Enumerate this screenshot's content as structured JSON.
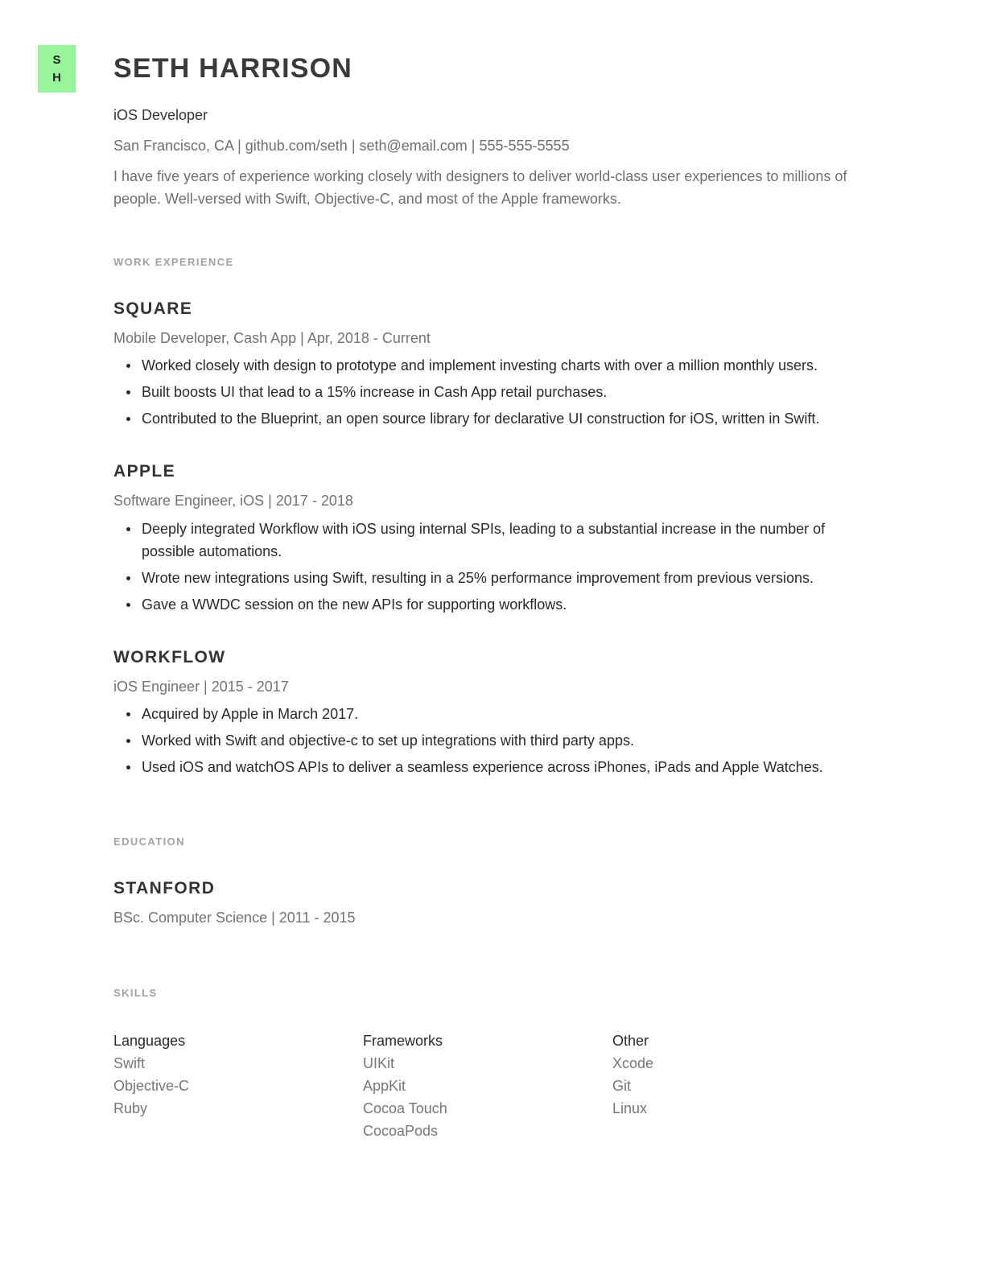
{
  "badge": {
    "line1": "S",
    "line2": "H",
    "color": "#98f59a"
  },
  "header": {
    "name": "SETH HARRISON",
    "title": "iOS Developer",
    "contact": "San Francisco, CA | github.com/seth | seth@email.com | 555-555-5555",
    "summary": "I have five years of experience working closely with designers to deliver world-class user experiences to millions of people. Well-versed with Swift, Objective-C, and most of the Apple frameworks."
  },
  "work": {
    "label": "WORK EXPERIENCE",
    "jobs": [
      {
        "company": "SQUARE",
        "role": "Mobile Developer, Cash App | Apr, 2018 - Current",
        "bullets": [
          "Worked closely with design to prototype and implement investing charts with over a million monthly users.",
          "Built boosts UI that lead to a 15% increase in Cash App retail purchases.",
          "Contributed to the Blueprint, an open source library for declarative UI construction for iOS, written in Swift."
        ]
      },
      {
        "company": "APPLE",
        "role": "Software Engineer, iOS | 2017 - 2018",
        "bullets": [
          "Deeply integrated Workflow with iOS using internal SPIs, leading to a substantial increase in the number of possible automations.",
          "Wrote new integrations using Swift, resulting in a 25% performance improvement from previous versions.",
          "Gave a WWDC session on the new APIs for supporting workflows."
        ]
      },
      {
        "company": "WORKFLOW",
        "role": "iOS Engineer | 2015 - 2017",
        "bullets": [
          "Acquired by Apple in March 2017.",
          "Worked with Swift and objective-c to set up integrations with third party apps.",
          "Used iOS and watchOS APIs to deliver a seamless experience across iPhones, iPads and Apple Watches."
        ]
      }
    ]
  },
  "education": {
    "label": "EDUCATION",
    "school": "STANFORD",
    "degree": "BSc. Computer Science | 2011 - 2015"
  },
  "skills": {
    "label": "SKILLS",
    "columns": [
      {
        "head": "Languages",
        "items": [
          "Swift",
          "Objective-C",
          "Ruby"
        ]
      },
      {
        "head": "Frameworks",
        "items": [
          "UIKit",
          "AppKit",
          "Cocoa Touch",
          "CocoaPods"
        ]
      },
      {
        "head": "Other",
        "items": [
          "Xcode",
          "Git",
          "Linux"
        ]
      }
    ]
  }
}
